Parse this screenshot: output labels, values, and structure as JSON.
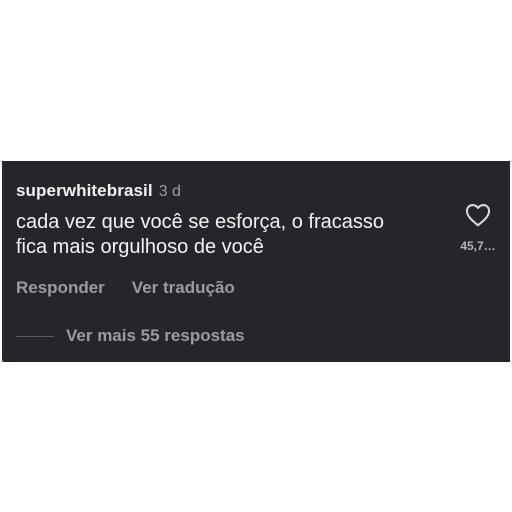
{
  "comment": {
    "username": "superwhitebrasil",
    "time": "3 d",
    "text_lines": [
      "cada vez que você se esforça, o fracasso",
      "fica mais orgulhoso de você"
    ],
    "like_count": "45,7…",
    "like_icon": "heart-outline-icon",
    "actions": {
      "reply": "Responder",
      "translate": "Ver tradução"
    },
    "more_replies": "Ver mais 55 respostas"
  },
  "colors": {
    "card_background": "#25262b",
    "primary_text": "#f2f2f2",
    "secondary_text": "#9b9ba1",
    "avatar_accent": "#b0398b"
  }
}
